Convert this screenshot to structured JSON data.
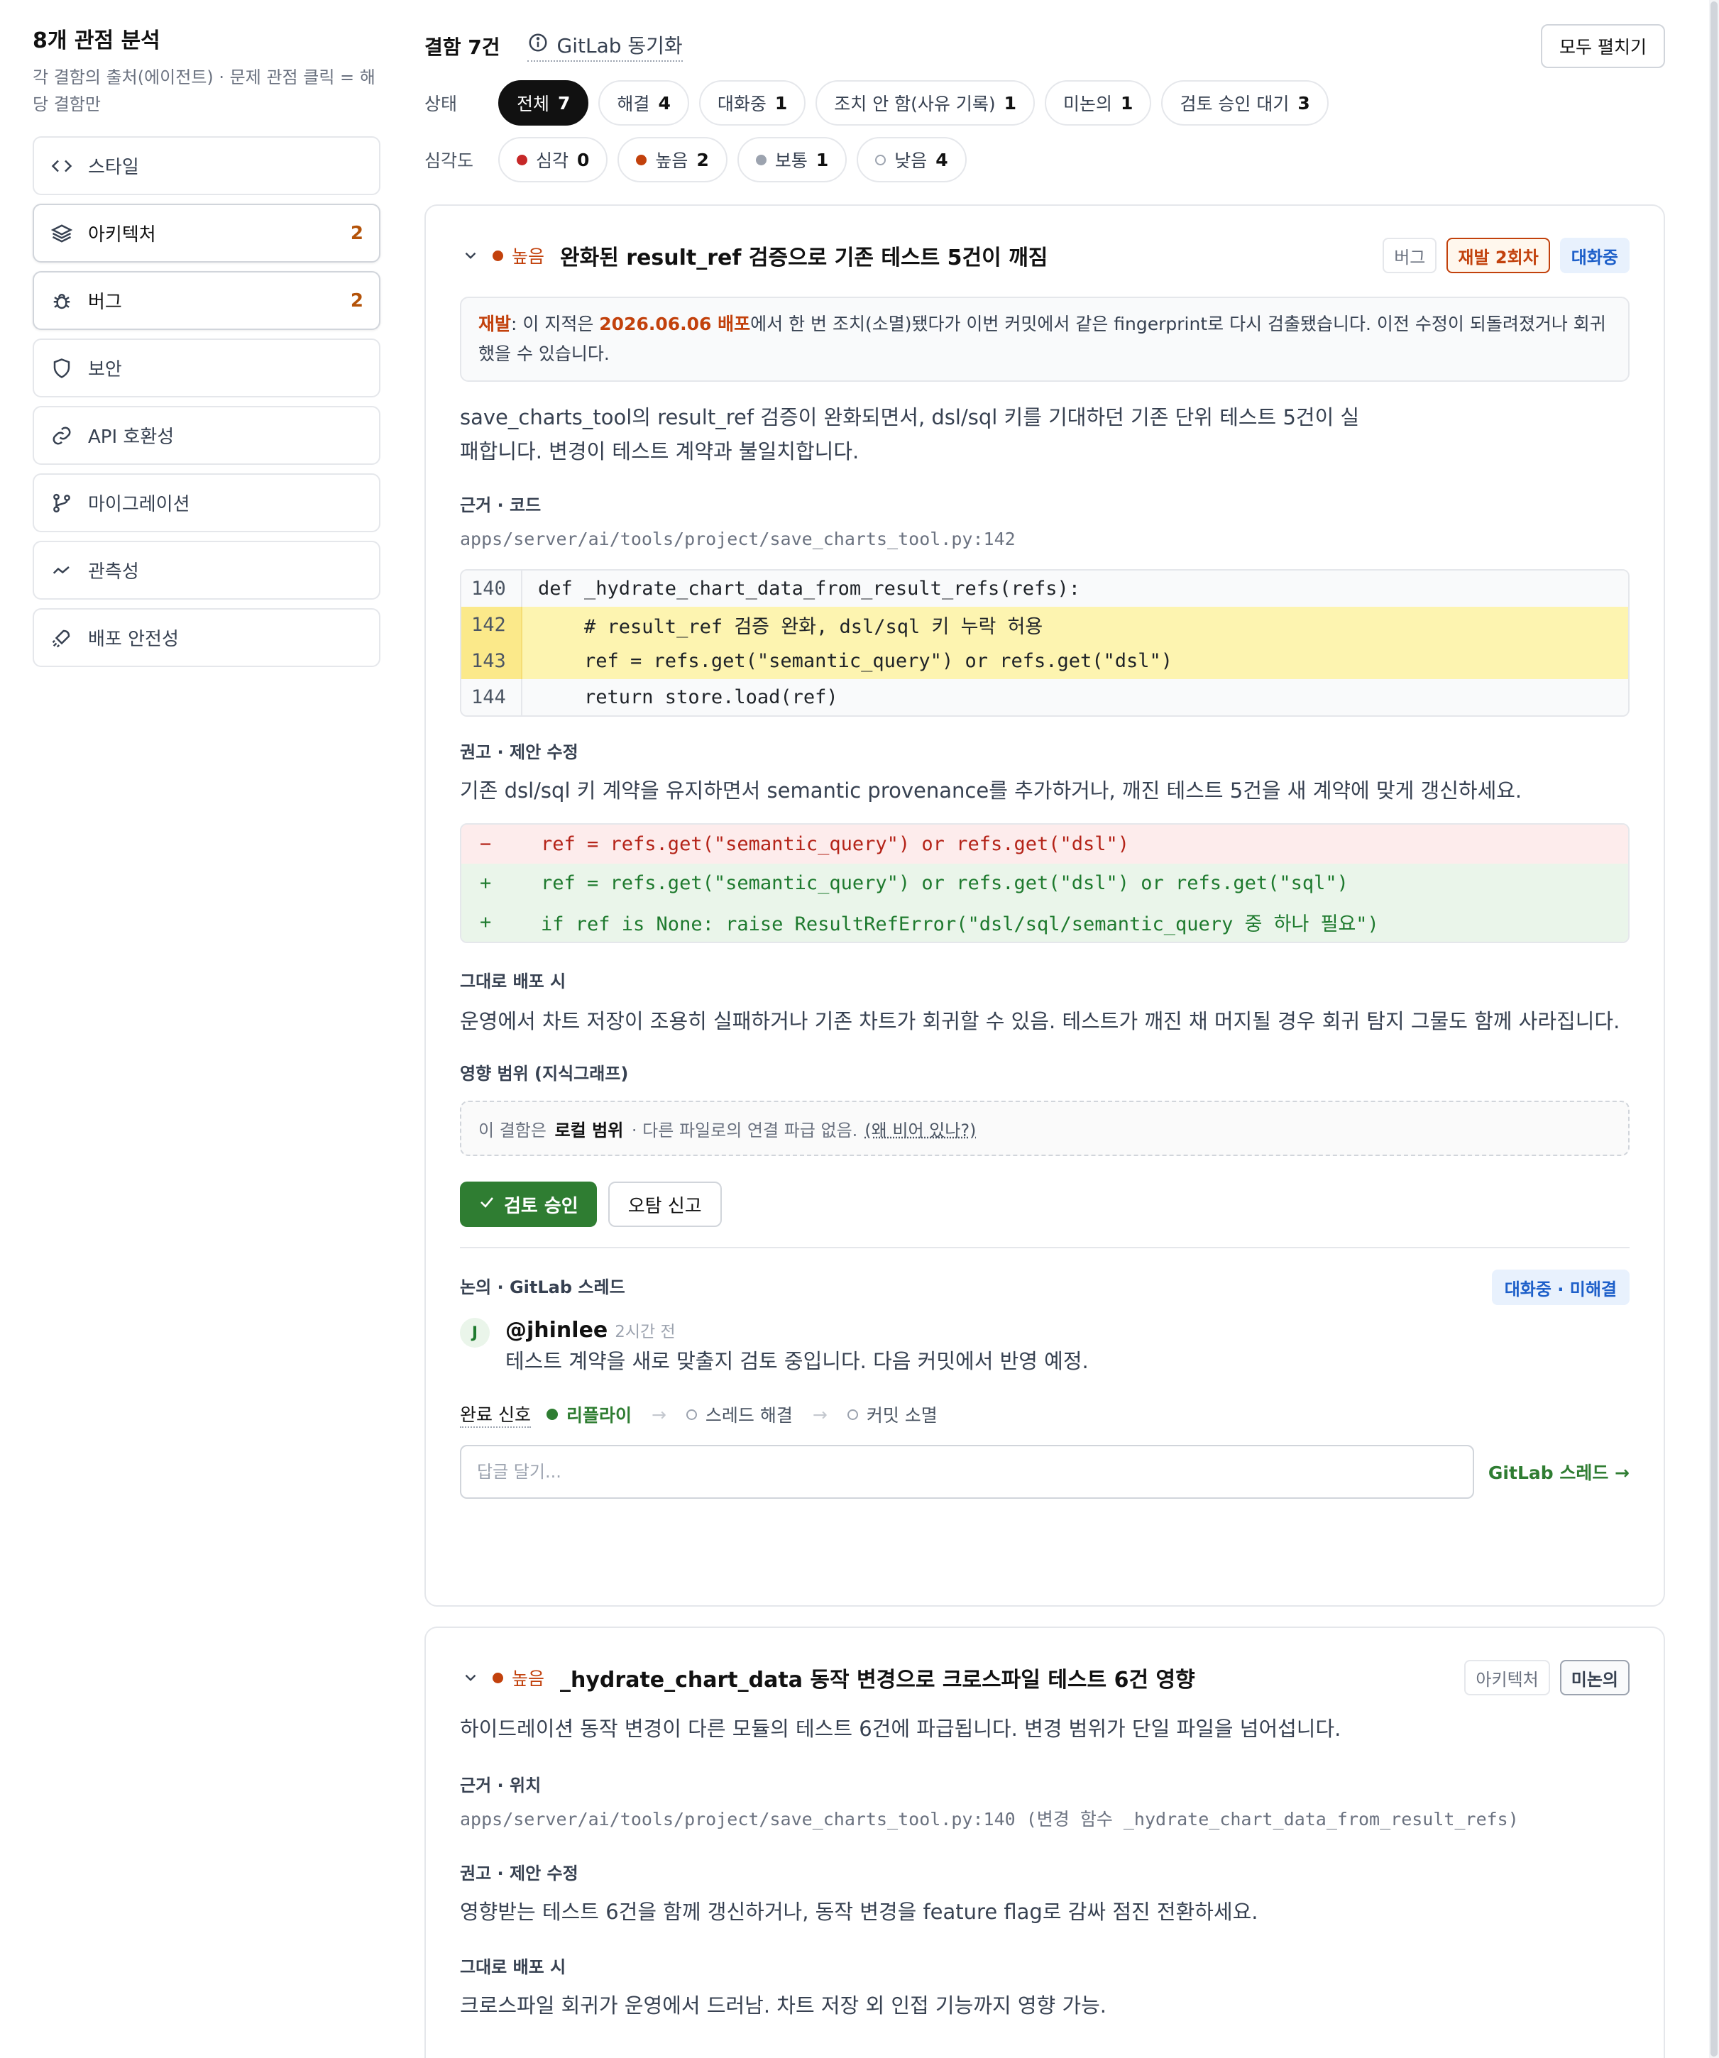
{
  "sidebar": {
    "title": "8개 관점 분석",
    "subtitle": "각 결함의 출처(에이전트) · 문제 관점 클릭 = 해당 결함만",
    "items": [
      {
        "label": "스타일",
        "count": "",
        "icon": "code-icon"
      },
      {
        "label": "아키텍처",
        "count": "2",
        "icon": "layers-icon"
      },
      {
        "label": "버그",
        "count": "2",
        "icon": "bug-icon"
      },
      {
        "label": "보안",
        "count": "",
        "icon": "shield-icon"
      },
      {
        "label": "API 호환성",
        "count": "",
        "icon": "link-icon"
      },
      {
        "label": "마이그레이션",
        "count": "",
        "icon": "git-branch-icon"
      },
      {
        "label": "관측성",
        "count": "",
        "icon": "trend-icon"
      },
      {
        "label": "배포 안전성",
        "count": "",
        "icon": "rocket-icon"
      }
    ]
  },
  "topbar": {
    "count_label": "결함 7건",
    "sync_label": "GitLab 동기화",
    "expand_label": "모두 펼치기"
  },
  "filters": {
    "status_label": "상태",
    "status": [
      {
        "label": "전체",
        "count": "7"
      },
      {
        "label": "해결",
        "count": "4"
      },
      {
        "label": "대화중",
        "count": "1"
      },
      {
        "label": "조치 안 함(사유 기록)",
        "count": "1"
      },
      {
        "label": "미논의",
        "count": "1"
      },
      {
        "label": "검토 승인 대기",
        "count": "3"
      }
    ],
    "severity_label": "심각도",
    "severity": [
      {
        "label": "심각",
        "count": "0",
        "color": "#c62828"
      },
      {
        "label": "높음",
        "count": "2",
        "color": "#c2410c"
      },
      {
        "label": "보통",
        "count": "1",
        "color": "#9ca3af"
      },
      {
        "label": "낮음",
        "count": "4",
        "color": "hollow"
      }
    ]
  },
  "finding1": {
    "severity": "높음",
    "title": "완화된 result_ref 검증으로 기존 테스트 5건이 깨짐",
    "badges": {
      "category": "버그",
      "recurrence": "재발 2회차",
      "status": "대화중"
    },
    "notice": {
      "prefix": "재발",
      "text1": ": 이 지적은 ",
      "deploy": "2026.06.06 배포",
      "text2": "에서 한 번 조치(소멸)됐다가 이번 커밋에서 같은 fingerprint로 다시 검출됐습니다. 이전 수정이 되돌려졌거나 회귀했을 수 있습니다."
    },
    "description": "save_charts_tool의 result_ref 검증이 완화되면서, dsl/sql 키를 기대하던 기존 단위 테스트 5건이 실패합니다. 변경이 테스트 계약과 불일치합니다.",
    "evidence_label": "근거 · 코드",
    "path": "apps/server/ai/tools/project/save_charts_tool.py:142",
    "code": [
      {
        "ln": "140",
        "src": "def _hydrate_chart_data_from_result_refs(refs):"
      },
      {
        "ln": "142",
        "src": "    # result_ref 검증 완화, dsl/sql 키 누락 허용"
      },
      {
        "ln": "143",
        "src": "    ref = refs.get(\"semantic_query\") or refs.get(\"dsl\")"
      },
      {
        "ln": "144",
        "src": "    return store.load(ref)"
      }
    ],
    "rec_label": "권고 · 제안 수정",
    "rec": "기존 dsl/sql 키 계약을 유지하면서 semantic provenance를 추가하거나, 깨진 테스트 5건을 새 계약에 맞게 갱신하세요.",
    "diff": [
      {
        "sign": "−",
        "src": "ref = refs.get(\"semantic_query\") or refs.get(\"dsl\")"
      },
      {
        "sign": "+",
        "src": "ref = refs.get(\"semantic_query\") or refs.get(\"dsl\") or refs.get(\"sql\")"
      },
      {
        "sign": "+",
        "src": "if ref is None: raise ResultRefError(\"dsl/sql/semantic_query 중 하나 필요\")"
      }
    ],
    "deploy_label": "그대로 배포 시",
    "deploy_text": "운영에서 차트 저장이 조용히 실패하거나 기존 차트가 회귀할 수 있음. 테스트가 깨진 채 머지될 경우 회귀 탐지 그물도 함께 사라집니다.",
    "impact_label": "영향 범위 (지식그래프)",
    "impact": {
      "pre": "이 결함은",
      "bold": "로컬 범위",
      "post": "· 다른 파일로의 연결 파급 없음.",
      "why": "(왜 비어 있나?)"
    },
    "approve_label": "검토 승인",
    "report_label": "오탐 신고",
    "discussion_label": "논의 · GitLab 스레드",
    "discussion_badge": "대화중 · 미해결",
    "comment": {
      "avatar": "J",
      "user": "@jhinlee",
      "time": "2시간 전",
      "body": "테스트 계약을 새로 맞출지 검토 중입니다. 다음 커밋에서 반영 예정."
    },
    "signals": {
      "title": "완료 신호",
      "s1": "리플라이",
      "s2": "스레드 해결",
      "s3": "커밋 소멸"
    },
    "reply_placeholder": "답글 달기...",
    "gitlab_link": "GitLab 스레드 →"
  },
  "finding2": {
    "severity": "높음",
    "title": "_hydrate_chart_data 동작 변경으로 크로스파일 테스트 6건 영향",
    "badges": {
      "category": "아키텍처",
      "status": "미논의"
    },
    "description": "하이드레이션 동작 변경이 다른 모듈의 테스트 6건에 파급됩니다. 변경 범위가 단일 파일을 넘어섭니다.",
    "evidence_label": "근거 · 위치",
    "path": "apps/server/ai/tools/project/save_charts_tool.py:140 (변경 함수 _hydrate_chart_data_from_result_refs)",
    "rec_label": "권고 · 제안 수정",
    "rec": "영향받는 테스트 6건을 함께 갱신하거나, 동작 변경을 feature flag로 감싸 점진 전환하세요.",
    "deploy_label": "그대로 배포 시",
    "deploy_text": "크로스파일 회귀가 운영에서 드러남. 차트 저장 외 인접 기능까지 영향 가능."
  }
}
